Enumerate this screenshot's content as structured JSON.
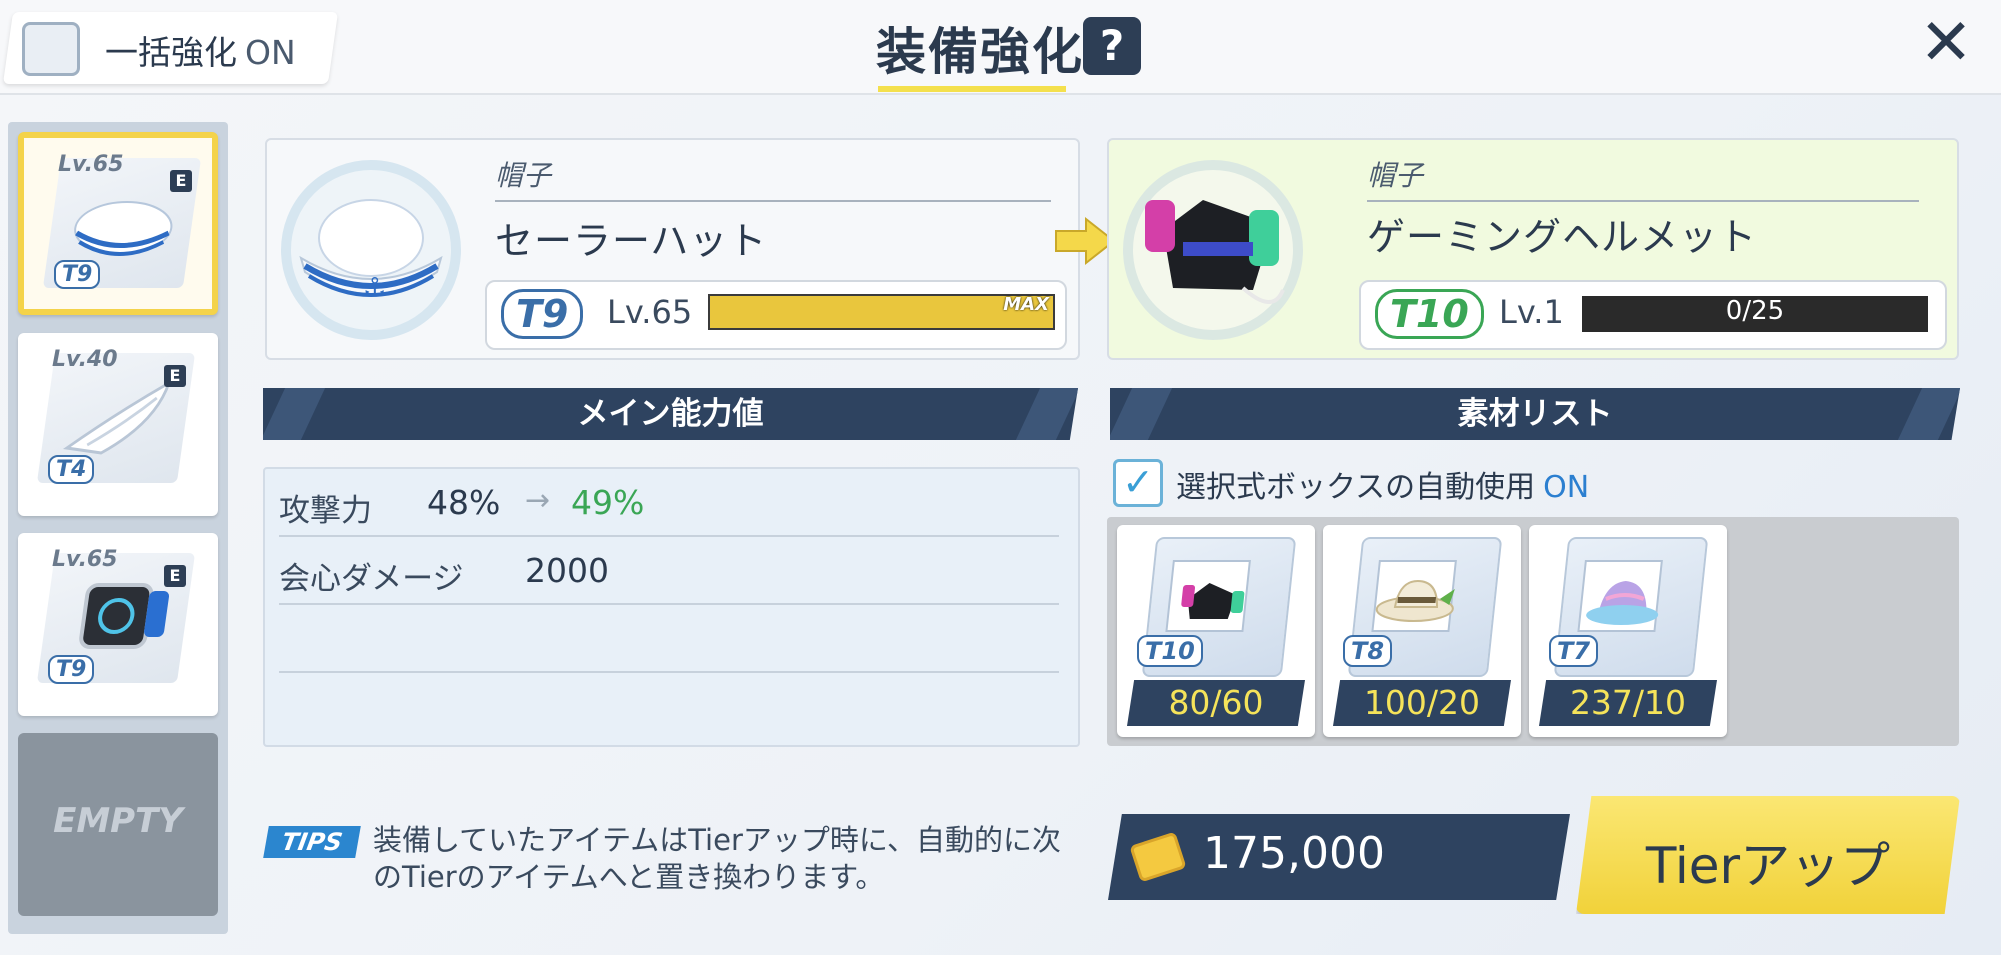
{
  "header": {
    "bulk_label": "一括強化",
    "bulk_state": "ON",
    "title": "装備強化",
    "help": "?",
    "close": "✕"
  },
  "equipment_list": [
    {
      "level": "Lv.65",
      "badge": "E",
      "tier": "T9",
      "item": "sailor-hat",
      "selected": true
    },
    {
      "level": "Lv.40",
      "badge": "E",
      "tier": "T4",
      "item": "wing-charm",
      "selected": false
    },
    {
      "level": "Lv.65",
      "badge": "E",
      "tier": "T9",
      "item": "smart-watch",
      "selected": false
    }
  ],
  "empty_slot": "EMPTY",
  "current_item": {
    "category": "帽子",
    "name": "セーラーハット",
    "tier": "T9",
    "level": "Lv.65",
    "bar_label": "MAX",
    "progress": 1.0
  },
  "next_item": {
    "category": "帽子",
    "name": "ゲーミングヘルメット",
    "tier": "T10",
    "level": "Lv.1",
    "exp": "0/25",
    "progress": 0.0
  },
  "main_stats": {
    "header": "メイン能力値",
    "rows": [
      {
        "name": "攻撃力",
        "current": "48%",
        "arrow": "→",
        "next": "49%"
      },
      {
        "name": "会心ダメージ",
        "current": "2000",
        "arrow": "",
        "next": ""
      }
    ]
  },
  "materials": {
    "header": "素材リスト",
    "auto_label": "選択式ボックスの自動使用",
    "auto_state": "ON",
    "auto_checked": true,
    "items": [
      {
        "tier": "T10",
        "count": "80/60",
        "icon": "gaming-helmet-blueprint-icon"
      },
      {
        "tier": "T8",
        "count": "100/20",
        "icon": "straw-hat-blueprint-icon"
      },
      {
        "tier": "T7",
        "count": "237/10",
        "icon": "bucket-hat-blueprint-icon"
      }
    ]
  },
  "tips": {
    "badge": "TIPS",
    "line1": "装備していたアイテムはTierアップ時に、自動的に次",
    "line2": "のTierのアイテムへと置き換わります。"
  },
  "cost": {
    "value": "175,000",
    "icon": "credit-icon"
  },
  "action_button": "Tierアップ",
  "colors": {
    "navy": "#2e4360",
    "accent_yellow": "#f4d34a",
    "stat_increase": "#3aa655",
    "on_blue": "#2b7fd0",
    "tier_current": "#3a6ea8",
    "tier_next": "#3aa655"
  }
}
